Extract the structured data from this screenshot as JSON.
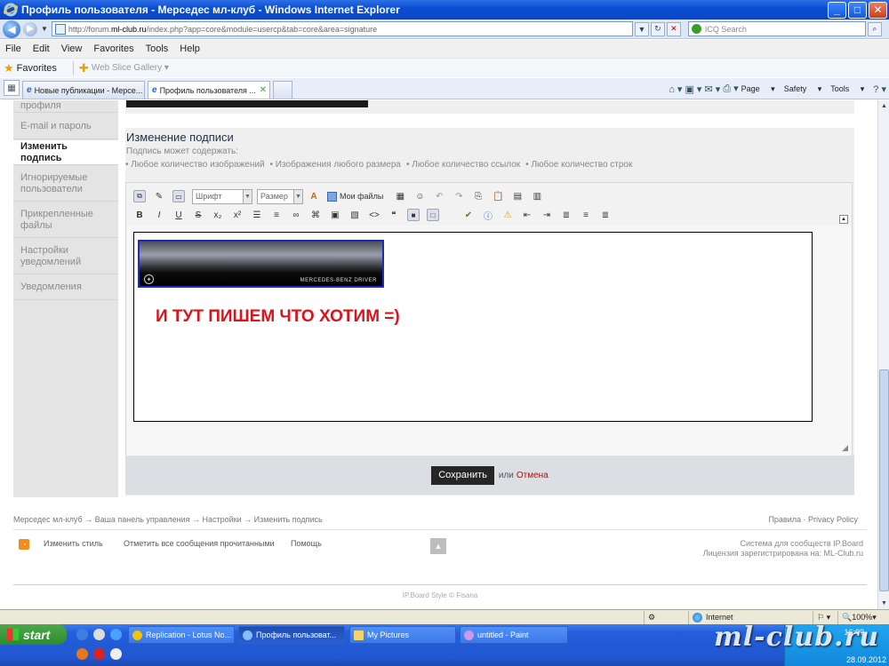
{
  "window": {
    "title": "Профиль пользователя - Мерседес мл-клуб - Windows Internet Explorer",
    "min": "_",
    "max": "□",
    "close": "✕"
  },
  "address": {
    "url_prefix": "http://forum.",
    "url_domain": "ml-club.ru",
    "url_path": "/index.php?app=core&module=usercp&tab=core&area=signature",
    "search_placeholder": "ICQ Search"
  },
  "menu": {
    "file": "File",
    "edit": "Edit",
    "view": "View",
    "favorites": "Favorites",
    "tools": "Tools",
    "help": "Help"
  },
  "favbar": {
    "favorites": "Favorites",
    "web_slice": "Web Slice Gallery"
  },
  "tabs": [
    {
      "label": "Новые публикации - Мерсе..."
    },
    {
      "label": "Профиль пользователя ..."
    }
  ],
  "ie_tools": {
    "page": "Page",
    "safety": "Safety",
    "tools": "Tools"
  },
  "sidebar": {
    "items": [
      {
        "label": "профиля"
      },
      {
        "label": "E-mail и пароль"
      },
      {
        "label": "Изменить подпись"
      },
      {
        "label": "Игнорируемые пользователи"
      },
      {
        "label": "Прикрепленные файлы"
      },
      {
        "label": "Настройки уведомлений"
      },
      {
        "label": "Уведомления"
      }
    ]
  },
  "main": {
    "heading": "Изменение подписи",
    "note": "Подпись может содержать:",
    "bullets": [
      "• Любое количество изображений",
      "• Изображения любого размера",
      "• Любое количество ссылок",
      "• Любое количество строк"
    ]
  },
  "editor": {
    "font_select": "Шрифт",
    "size_select": "Размер",
    "my_files": "Мои файлы",
    "banner_caption": "MERCEDES-BENZ DRIVER",
    "signature_text": "И ТУТ ПИШЕМ ЧТО ХОТИМ =)"
  },
  "actions": {
    "save": "Сохранить",
    "or": "или",
    "cancel": "Отмена"
  },
  "footer": {
    "breadcrumb": "Мерседес мл-клуб  →  Ваша панель управления  →  Настройки  →  Изменить подпись",
    "rules": "Правила",
    "privacy": "Privacy Policy",
    "change_style": "Изменить стиль",
    "mark_read": "Отметить все сообщения прочитанными",
    "help": "Помощь",
    "system": "Система для сообществ IP.Board",
    "license": "Лицензия зарегистрирована на: ML-Club.ru",
    "copyright": "IP.Board Style © Fisana"
  },
  "statusbar": {
    "zone": "Internet",
    "zoom": "100%"
  },
  "taskbar": {
    "start": "start",
    "items": [
      {
        "label": "Replication - Lotus No..."
      },
      {
        "label": "Профиль пользоват..."
      },
      {
        "label": "My Pictures"
      },
      {
        "label": "untitled - Paint"
      }
    ],
    "clock": "16:09",
    "date": "28.09.2012"
  },
  "watermark": "ml-club.ru"
}
